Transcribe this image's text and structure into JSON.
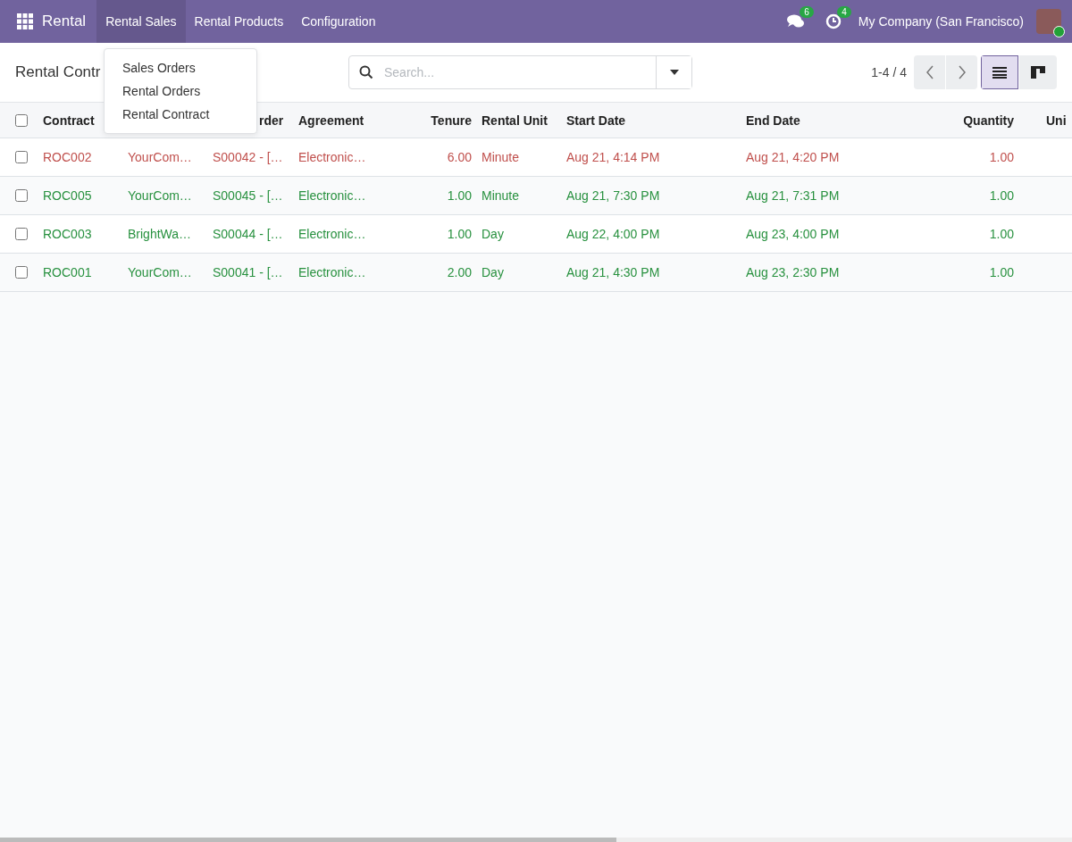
{
  "navbar": {
    "app_name": "Rental",
    "menu": [
      {
        "label": "Rental Sales",
        "selected": true
      },
      {
        "label": "Rental Products",
        "selected": false
      },
      {
        "label": "Configuration",
        "selected": false
      }
    ],
    "messages_badge": "6",
    "activities_badge": "4",
    "company": "My Company (San Francisco)"
  },
  "dropdown": {
    "items": [
      "Sales Orders",
      "Rental Orders",
      "Rental Contract"
    ]
  },
  "control_panel": {
    "title": "Rental Contr",
    "search": {
      "placeholder": "Search..."
    },
    "pager": "1-4 / 4",
    "views": [
      {
        "kind": "list",
        "selected": true
      },
      {
        "kind": "kanban",
        "selected": false
      }
    ]
  },
  "table": {
    "all_checked": false,
    "columns": [
      "Contract",
      null,
      "rder",
      "Agreement",
      "Tenure",
      "Rental Unit",
      "Start Date",
      "End Date",
      "Quantity",
      "Uni"
    ],
    "rows": [
      {
        "checked": false,
        "color": "#c0504d",
        "cells": [
          "ROC002",
          "YourCom…",
          "S00042 - […",
          "Electronic…",
          "6.00",
          "Minute",
          "Aug 21, 4:14 PM",
          "Aug 21, 4:20 PM",
          "1.00"
        ]
      },
      {
        "checked": false,
        "color": "#28913f",
        "cells": [
          "ROC005",
          "YourCom…",
          "S00045 - […",
          "Electronic…",
          "1.00",
          "Minute",
          "Aug 21, 7:30 PM",
          "Aug 21, 7:31 PM",
          "1.00"
        ]
      },
      {
        "checked": false,
        "color": "#28913f",
        "cells": [
          "ROC003",
          "BrightWa…",
          "S00044 - […",
          "Electronic…",
          "1.00",
          "Day",
          "Aug 22, 4:00 PM",
          "Aug 23, 4:00 PM",
          "1.00"
        ]
      },
      {
        "checked": false,
        "color": "#28913f",
        "cells": [
          "ROC001",
          "YourCom…",
          "S00041 - […",
          "Electronic…",
          "2.00",
          "Day",
          "Aug 21, 4:30 PM",
          "Aug 23, 2:30 PM",
          "1.00"
        ]
      }
    ]
  }
}
